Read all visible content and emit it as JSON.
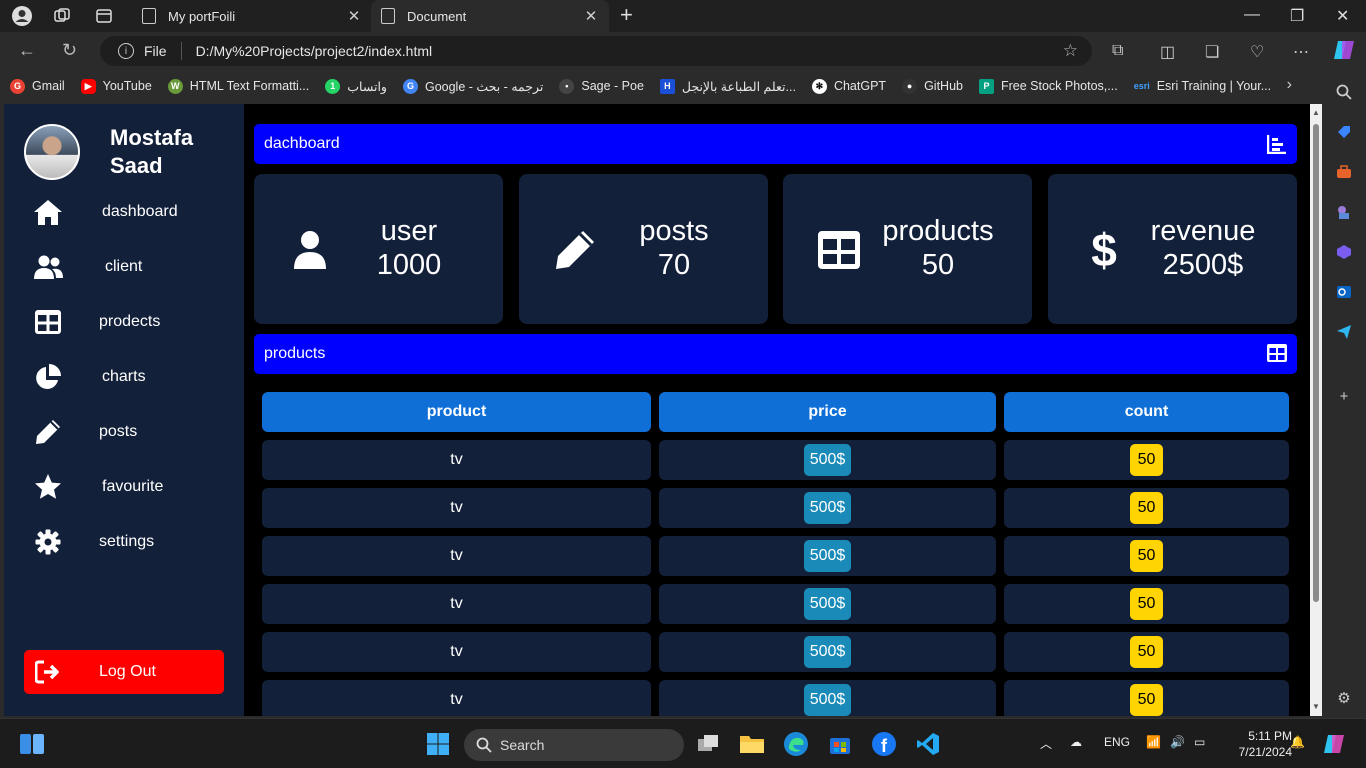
{
  "browser": {
    "tabs": [
      {
        "label": "My portFoili",
        "close": "✕"
      },
      {
        "label": "Document",
        "close": "✕"
      }
    ],
    "new_tab": "+",
    "address": {
      "scheme_label": "File",
      "url": "D:/My%20Projects/project2/index.html"
    },
    "bookmarks": [
      {
        "label": "Gmail",
        "color": "#ea4335"
      },
      {
        "label": "YouTube",
        "color": "#ff0000"
      },
      {
        "label": "HTML Text Formatti...",
        "color": "#6a9a3a"
      },
      {
        "label": "واتساب",
        "color": "#25d366"
      },
      {
        "label": "Google - ترجمه - بحث",
        "color": "#4285f4"
      },
      {
        "label": "Sage - Poe",
        "color": "#444444"
      },
      {
        "label": "تعلم الطباعة بالإنجل...",
        "color": "#1a4fd8"
      },
      {
        "label": "ChatGPT",
        "color": "#ffffff"
      },
      {
        "label": "GitHub",
        "color": "#333333"
      },
      {
        "label": "Free Stock Photos,...",
        "color": "#05a081"
      },
      {
        "label": "Esri Training | Your...",
        "color": "#1f77c9"
      }
    ]
  },
  "sidebar": {
    "user_name": "Mostafa Saad",
    "items": [
      {
        "label": "dashboard",
        "icon": "home-icon"
      },
      {
        "label": "client",
        "icon": "users-icon"
      },
      {
        "label": "prodects",
        "icon": "table-icon"
      },
      {
        "label": "charts",
        "icon": "pie-chart-icon"
      },
      {
        "label": "posts",
        "icon": "pencil-icon"
      },
      {
        "label": "favourite",
        "icon": "star-icon"
      },
      {
        "label": "settings",
        "icon": "gear-icon"
      }
    ],
    "logout_label": "Log Out"
  },
  "main": {
    "dashboard_header": "dachboard",
    "cards": [
      {
        "label": "user",
        "value": "1000",
        "icon": "user-icon"
      },
      {
        "label": "posts",
        "value": "70",
        "icon": "pencil-icon"
      },
      {
        "label": "products",
        "value": "50",
        "icon": "table-icon"
      },
      {
        "label": "revenue",
        "value": "2500$",
        "icon": "dollar-icon"
      }
    ],
    "products_header": "products",
    "table": {
      "columns": [
        "product",
        "price",
        "count"
      ],
      "rows": [
        [
          "tv",
          "500$",
          "50"
        ],
        [
          "tv",
          "500$",
          "50"
        ],
        [
          "tv",
          "500$",
          "50"
        ],
        [
          "tv",
          "500$",
          "50"
        ],
        [
          "tv",
          "500$",
          "50"
        ],
        [
          "tv",
          "500$",
          "50"
        ]
      ]
    }
  },
  "taskbar": {
    "search_placeholder": "Search",
    "language": "ENG",
    "time": "5:11 PM",
    "date": "7/21/2024"
  },
  "colors": {
    "sidebar_bg": "#13203a",
    "header_blue": "#0000ff",
    "table_head": "#0f6fd6",
    "price_badge": "#1a8ab8",
    "count_badge": "#ffd400",
    "logout": "#ff0000"
  }
}
